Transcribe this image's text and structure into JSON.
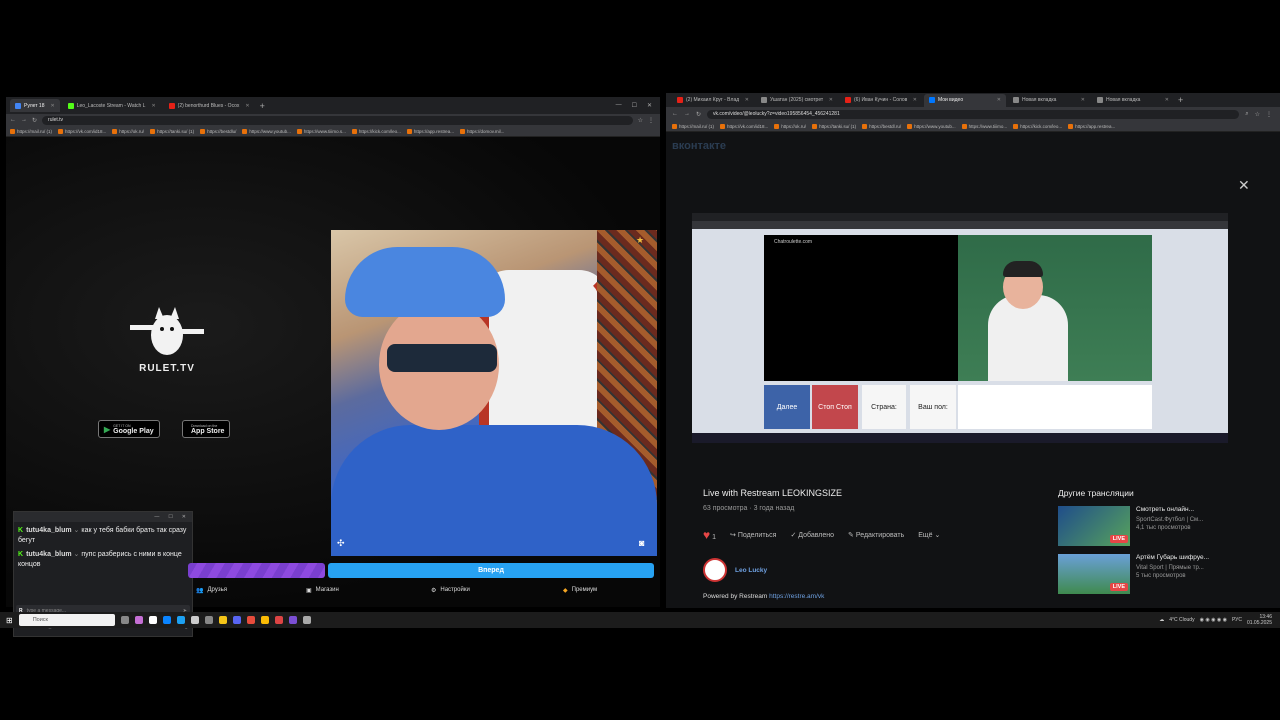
{
  "left_browser": {
    "tabs": [
      {
        "label": "Рулет 18",
        "color": "#4285f4"
      },
      {
        "label": "Leo_Lacoste Stream - Watch L",
        "color": "#53fc18"
      },
      {
        "label": "(2) benorthurd Blues - Ocox",
        "color": "#e62117"
      }
    ],
    "url": "rulet.tv",
    "bookmarks": [
      "https://mail.ru/ (1)",
      "https://vk.com/id18...",
      "https://ok.ru/",
      "https://tanki.su/ (1)",
      "https://bestdlu/",
      "https://www.youtub...",
      "https://www.tiiimo.s...",
      "https://kick.com/leo...",
      "https://app.restrea...",
      "https://domov.mil..."
    ]
  },
  "rulet": {
    "brand": "RULET.TV",
    "google_play_small": "GET IT ON",
    "google_play": "Google Play",
    "app_store_small": "Download on the",
    "app_store": "App Store"
  },
  "chat": {
    "messages": [
      {
        "user": "tutu4ka_blum",
        "text": "как у тебя бабки брать так сразу бегут"
      },
      {
        "user": "tutu4ka_blum",
        "text": "пупс разберись с ними в конце концов"
      }
    ],
    "input_placeholder": "type a message...",
    "footer_channel": "Botanic Leo_Lacostez",
    "footer_count": "1/1",
    "footer_viewers": "3",
    "footer_right": "Montage"
  },
  "rulet_bar": {
    "next_label": "Вперед"
  },
  "rulet_nav": [
    "Друзья",
    "Магазин",
    "Настройки",
    "Премиум"
  ],
  "right_browser": {
    "tabs": [
      "(2) Михаил Круг - Владимир",
      "Ушатан (2025) смотреть онл",
      "(6) Иван Кучин - Соловей",
      "Мои видео",
      "Новая вкладка",
      "Новая вкладка"
    ],
    "url": "vk.com/video/@leolucky?z=video195856454_456241281",
    "bookmarks": [
      "https://mail.ru/ (1)",
      "https://vk.com/id18...",
      "https://ok.ru/",
      "https://tanki.su/ (1)",
      "https://bestdl.ru/",
      "https://www.youtub...",
      "https://www.tiiimo...",
      "https://kick.com/leo...",
      "https://app.restrea..."
    ]
  },
  "vk": {
    "logo": "вконтакте",
    "inner": {
      "site": "Chatroulette.com",
      "btn_next": "Далее",
      "btn_stop": "Стоп Стоп",
      "country": "Страна:",
      "gender": "Ваш пол:"
    },
    "title": "Live with Restream LEOKINGSIZE",
    "views": "63 просмотра",
    "age": "3 года назад",
    "likes": "1",
    "share": "Поделиться",
    "added": "Добавлено",
    "edit": "Редактировать",
    "more": "Ещё",
    "author": "Leo Lucky",
    "powered_prefix": "Powered by Restream",
    "powered_link": "https://restre.am/vk",
    "other_title": "Другие трансляции",
    "other": [
      {
        "title": "Смотреть онлайн...",
        "sub1": "SportCast.Футбол | См...",
        "sub2": "4,1 тыс просмотров",
        "badge": "LIVE"
      },
      {
        "title": "Артём Губарь шифруе...",
        "sub1": "Vital Sport | Прямые тр...",
        "sub2": "5 тыс просмотров",
        "badge": "LIVE"
      }
    ]
  },
  "taskbar": {
    "search": "Поиск",
    "weather": "4°C Cloudy",
    "lang": "РУС",
    "time": "13:46",
    "date": "01.05.2025"
  }
}
